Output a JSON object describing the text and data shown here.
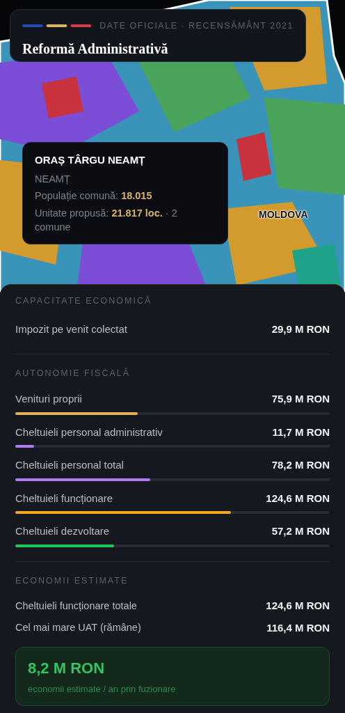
{
  "header": {
    "kicker": "DATE OFICIALE · RECENSĂMÂNT 2021",
    "title": "Reformă Administrativă"
  },
  "map": {
    "kind": "picture",
    "region_label": "MOLDOVA"
  },
  "tooltip": {
    "title": "ORAȘ TÂRGU NEAMȚ",
    "county": "NEAMȚ",
    "population_label": "Populație comună:",
    "population_value": "18.015",
    "unit_label": "Unitate propusă:",
    "unit_value": "21.817 loc.",
    "unit_suffix": "· 2 comune"
  },
  "sections": [
    {
      "title": "CAPACITATE ECONOMICĂ",
      "rows": [
        {
          "kind": "plain",
          "label": "Impozit pe venit colectat",
          "value": "29,9 M RON"
        }
      ]
    },
    {
      "title": "AUTONOMIE FISCALĂ",
      "rows": [
        {
          "kind": "bar",
          "label": "Venituri proprii",
          "value": "75,9 M RON",
          "level": 0.39,
          "color": "#e0b35a"
        },
        {
          "kind": "bar",
          "label": "Cheltuieli personal administrativ",
          "value": "11,7 M RON",
          "level": 0.06,
          "color": "#b07cf0"
        },
        {
          "kind": "bar",
          "label": "Cheltuieli personal total",
          "value": "78,2 M RON",
          "level": 0.43,
          "color": "#b07cf0"
        },
        {
          "kind": "bar",
          "label": "Cheltuieli funcționare",
          "value": "124,6 M RON",
          "level": 0.685,
          "color": "#f5a623"
        },
        {
          "kind": "bar",
          "label": "Cheltuieli dezvoltare",
          "value": "57,2 M RON",
          "level": 0.315,
          "color": "#22c55e"
        }
      ]
    },
    {
      "title": "ECONOMII ESTIMATE",
      "rows": [
        {
          "kind": "compact",
          "label": "Cheltuieli funcționare totale",
          "value": "124,6 M RON"
        },
        {
          "kind": "compact",
          "label": "Cel mai mare UAT (rămâne)",
          "value": "116,4 M RON"
        }
      ],
      "highlight": {
        "value": "8,2 M RON",
        "caption": "economii estimate / an prin fuzionare"
      }
    }
  ]
}
